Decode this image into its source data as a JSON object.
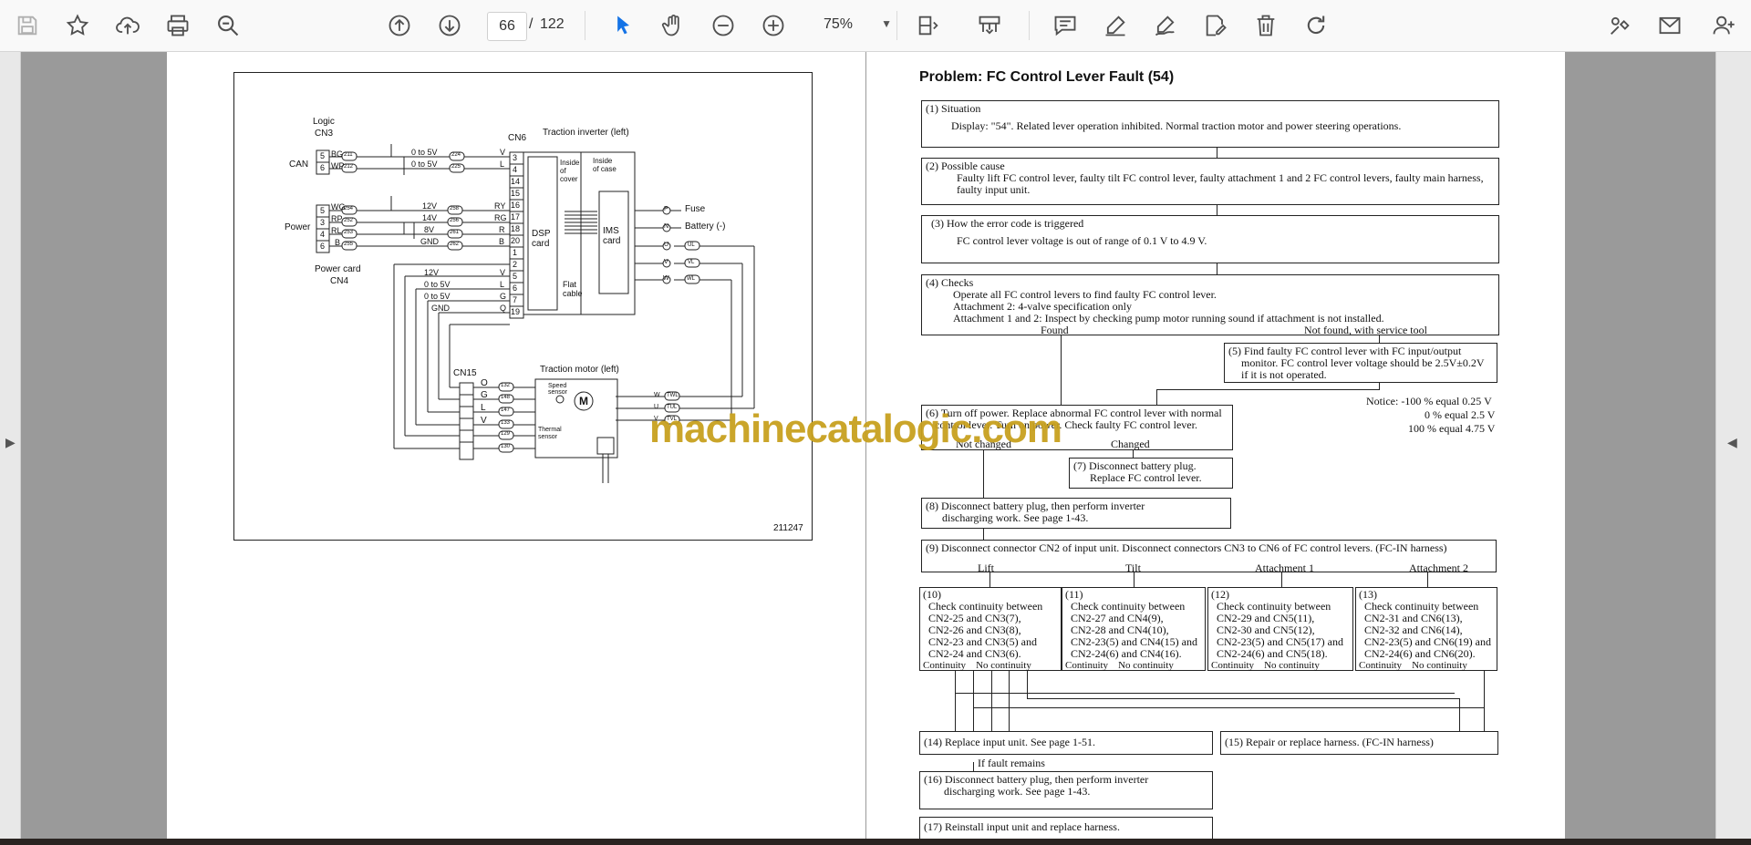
{
  "toolbar": {
    "page_current": "66",
    "page_sep": "/",
    "page_total": "122",
    "zoom": "75%",
    "icons": [
      "save-icon",
      "bookmark-star-icon",
      "upload-cloud-icon",
      "print-icon",
      "zoom-search-icon",
      "page-up-icon",
      "page-down-icon",
      "select-pointer-icon",
      "hand-pan-icon",
      "zoom-out-icon",
      "zoom-in-icon",
      "fit-page-icon",
      "scan-icon",
      "comment-icon",
      "highlight-pen-icon",
      "sign-icon",
      "edit-icon",
      "delete-icon",
      "redo-icon",
      "tools-icon",
      "mail-icon",
      "add-user-icon"
    ]
  },
  "diagram": {
    "logic_label": "Logic",
    "cn3_label": "CN3",
    "can_label": "CAN",
    "power_label": "Power",
    "power_card_label": "Power card",
    "cn4_label": "CN4",
    "cn6_label": "CN6",
    "traction_inverter_label": "Traction inverter (left)",
    "inside_cover": "Inside of cover",
    "inside_case": "Inside of case",
    "dsp_card": "DSP card",
    "ims_card": "IMS card",
    "flat_cable": "Flat cable",
    "fuse": "Fuse",
    "battery": "Battery (-)",
    "cn15_label": "CN15",
    "traction_motor_label": "Traction motor (left)",
    "speed_sensor": "Speed sensor",
    "thermal_sensor": "Thermal sensor",
    "figure_number": "211247",
    "cn3_pins": [
      "5",
      "6"
    ],
    "cn3_wires": [
      "BG",
      "WP"
    ],
    "cn3_tags": [
      "211",
      "212"
    ],
    "cn3_volts": [
      "0 to 5V",
      "0 to 5V"
    ],
    "cn3_tags_r": [
      "224",
      "225"
    ],
    "cn3_wires_r": [
      "V",
      "L"
    ],
    "cn4_pins": [
      "5",
      "3",
      "4",
      "6"
    ],
    "cn4_wires": [
      "WG",
      "RP",
      "RL",
      "B"
    ],
    "cn4_tags": [
      "254",
      "252",
      "253",
      "255"
    ],
    "cn4_volts": [
      "12V",
      "14V",
      "8V",
      "GND"
    ],
    "cn4_tags_r": [
      "258",
      "256",
      "261",
      "262"
    ],
    "cn4_wires_r": [
      "RY",
      "RG",
      "R",
      "B"
    ],
    "cn6_pins": [
      "3",
      "4",
      "14",
      "15",
      "16",
      "17",
      "18",
      "20",
      "1",
      "2",
      "5",
      "6",
      "7",
      "19"
    ],
    "cn15_volts": [
      "12V",
      "0 to 5V",
      "0 to 5V",
      "GND"
    ],
    "cn15_wires": [
      "V",
      "L",
      "G",
      "Q"
    ],
    "cn15_pins": [
      "O",
      "G",
      "L",
      "V"
    ],
    "cn15_tags": [
      "132",
      "148",
      "147",
      "133",
      "129",
      "130"
    ],
    "term_pins": [
      "P",
      "N",
      "U",
      "V",
      "W"
    ],
    "term_tags": [
      "UL",
      "VL",
      "WL"
    ],
    "motor_pins": [
      "W",
      "U",
      "V"
    ],
    "motor_tags": [
      "TWL",
      "TUL",
      "TVL"
    ]
  },
  "page": {
    "title": "Problem: FC Control Lever Fault (54)",
    "box1_head": "(1) Situation",
    "box1_body": "Display: \"54\". Related lever operation inhibited. Normal traction motor and power steering operations.",
    "box2_head": "(2) Possible cause",
    "box2_body1": "Faulty lift FC control lever, faulty tilt FC control lever, faulty attachment 1 and 2 FC control levers, faulty main harness,",
    "box2_body2": "faulty input unit.",
    "box3_head": "(3) How the error code is triggered",
    "box3_body": "FC control lever voltage is out of range of 0.1 V to 4.9 V.",
    "box4_head": "(4) Checks",
    "box4_body1": "Operate all FC control levers to find faulty FC control lever.",
    "box4_body2": "Attachment 2: 4-valve specification only",
    "box4_body3": "Attachment 1 and 2: Inspect by checking pump motor running sound if attachment is not installed.",
    "found": "Found",
    "not_found": "Not found, with service tool",
    "box5_line1": "(5) Find faulty FC control lever with FC input/output",
    "box5_line2": "monitor. FC control lever voltage should be 2.5V±0.2V",
    "box5_line3": "if it is not operated.",
    "notice1": "Notice: -100 % equal 0.25 V",
    "notice2": "0 % equal 2.5 V",
    "notice3": "100 % equal 4.75 V",
    "box6_line1": "(6) Turn off power. Replace abnormal FC control lever with normal",
    "box6_line2": "control lever. Turn on power. Check faulty FC control lever.",
    "not_changed": "Not changed",
    "changed": "Changed",
    "box7_line1": "(7) Disconnect battery plug.",
    "box7_line2": "Replace FC control lever.",
    "box8_line1": "(8) Disconnect battery plug, then perform inverter",
    "box8_line2": "discharging work. See page 1-43.",
    "box9": "(9) Disconnect connector CN2 of input unit. Disconnect connectors CN3 to CN6 of FC control levers.    (FC-IN harness)",
    "lift": "Lift",
    "tilt": "Tilt",
    "attachment1": "Attachment 1",
    "attachment2": "Attachment 2",
    "box10": [
      "(10)",
      "Check continuity between",
      "CN2-25 and CN3(7),",
      "CN2-26 and CN3(8),",
      "CN2-23 and CN3(5) and",
      "CN2-24 and CN3(6)."
    ],
    "box11": [
      "(11)",
      "Check continuity between",
      "CN2-27 and CN4(9),",
      "CN2-28 and CN4(10),",
      "CN2-23(5) and CN4(15) and",
      "CN2-24(6) and CN4(16)."
    ],
    "box12": [
      "(12)",
      "Check continuity between",
      "CN2-29 and CN5(11),",
      "CN2-30 and CN5(12),",
      "CN2-23(5) and CN5(17) and",
      "CN2-24(6) and CN5(18)."
    ],
    "box13": [
      "(13)",
      "Check continuity between",
      "CN2-31 and CN6(13),",
      "CN2-32 and CN6(14),",
      "CN2-23(5) and CN6(19) and",
      "CN2-24(6) and CN6(20)."
    ],
    "continuity": "Continuity",
    "no_continuity": "No continuity",
    "box14": "(14) Replace input unit. See page 1-51.",
    "box15": "(15)  Repair or replace harness. (FC-IN harness)",
    "if_fault": "If fault remains",
    "box16_line1": "(16) Disconnect battery plug, then perform inverter",
    "box16_line2": "discharging work. See page 1-43.",
    "box17": "(17) Reinstall input unit and replace harness."
  },
  "watermark": "machinecatalogic.com"
}
